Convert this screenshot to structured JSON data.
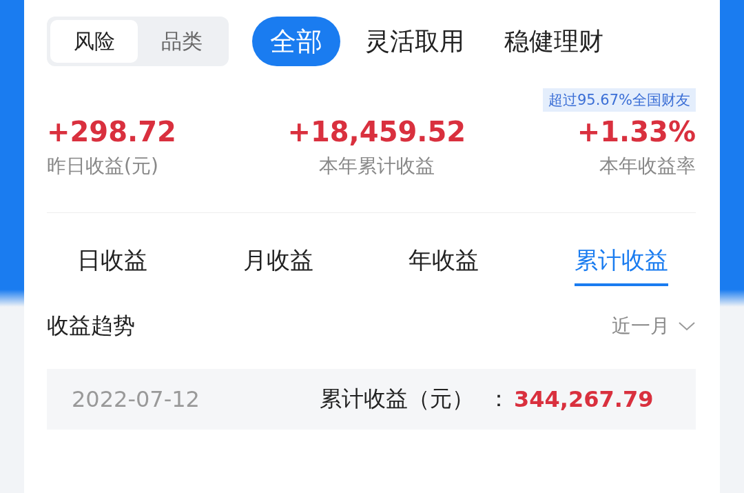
{
  "filter_toggle": [
    {
      "label": "风险",
      "selected": true
    },
    {
      "label": "品类",
      "selected": false
    }
  ],
  "category_tabs": [
    {
      "label": "全部",
      "selected": true
    },
    {
      "label": "灵活取用",
      "selected": false
    },
    {
      "label": "稳健理财",
      "selected": false
    }
  ],
  "rank_badge": "超过95.67%全国财友",
  "stats": [
    {
      "value": "+298.72",
      "label": "昨日收益(元)"
    },
    {
      "value": "+18,459.52",
      "label": "本年累计收益"
    },
    {
      "value": "+1.33%",
      "label": "本年收益率"
    }
  ],
  "period_tabs": [
    {
      "label": "日收益",
      "selected": false
    },
    {
      "label": "月收益",
      "selected": false
    },
    {
      "label": "年收益",
      "selected": false
    },
    {
      "label": "累计收益",
      "selected": true
    }
  ],
  "trend": {
    "title": "收益趋势",
    "range": "近一月"
  },
  "detail": {
    "date": "2022-07-12",
    "label": "累计收益（元）",
    "separator": "：",
    "value": "344,267.79"
  }
}
